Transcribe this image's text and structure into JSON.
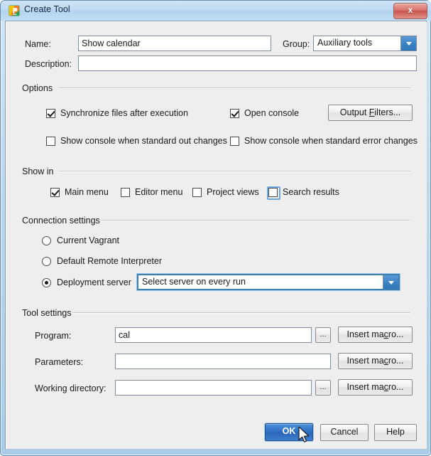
{
  "window": {
    "title": "Create Tool",
    "icon": "pycharm-logo-icon",
    "close_label": "x"
  },
  "form": {
    "name_label": "Name:",
    "name_value": "Show calendar",
    "name_placeholder": "",
    "group_label": "Group:",
    "group_value": "Auxiliary tools",
    "description_label": "Description:",
    "description_value": "",
    "description_placeholder": ""
  },
  "options": {
    "title": "Options",
    "checkboxes": [
      {
        "label": "Synchronize files after execution",
        "checked": true
      },
      {
        "label": "Open console",
        "checked": true
      },
      {
        "label": "Show console when standard out changes",
        "checked": false
      },
      {
        "label": "Show console when standard error changes",
        "checked": false
      }
    ],
    "output_filters_button": "Output Filters...",
    "output_filters_mnemonic": "F"
  },
  "show_in": {
    "title": "Show in",
    "checkboxes": [
      {
        "label": "Main menu",
        "checked": true,
        "focused": false
      },
      {
        "label": "Editor menu",
        "checked": false,
        "focused": false
      },
      {
        "label": "Project views",
        "checked": false,
        "focused": false
      },
      {
        "label": "Search results",
        "checked": false,
        "focused": true
      }
    ]
  },
  "connection_settings": {
    "title": "Connection settings",
    "radios": [
      {
        "label": "Current Vagrant",
        "selected": false
      },
      {
        "label": "Default Remote Interpreter",
        "selected": false
      },
      {
        "label": "Deployment server",
        "selected": true
      }
    ],
    "server_combo_value": "Select server on every run"
  },
  "tool_settings": {
    "title": "Tool settings",
    "rows": [
      {
        "label": "Program:",
        "value": "cal",
        "placeholder": "",
        "browse_label": "...",
        "macro_label": "Insert macro...",
        "macro_mnemonic": "c",
        "has_browse": true
      },
      {
        "label": "Parameters:",
        "value": "",
        "placeholder": "",
        "browse_label": "...",
        "macro_label": "Insert macro...",
        "macro_mnemonic": "c",
        "has_browse": false
      },
      {
        "label": "Working directory:",
        "value": "",
        "placeholder": "",
        "browse_label": "...",
        "macro_label": "Insert macro...",
        "macro_mnemonic": "c",
        "has_browse": true
      }
    ]
  },
  "footer": {
    "ok_label": "OK",
    "cancel_label": "Cancel",
    "help_label": "Help"
  },
  "colors": {
    "accent_blue": "#2f6fc4",
    "combo_arrow_blue": "#3d84c6",
    "focus_ring": "#6fa8dc",
    "dialog_bg": "#eeeeee",
    "titlebar_top": "#cfe4f6",
    "close_red": "#c8534b"
  }
}
